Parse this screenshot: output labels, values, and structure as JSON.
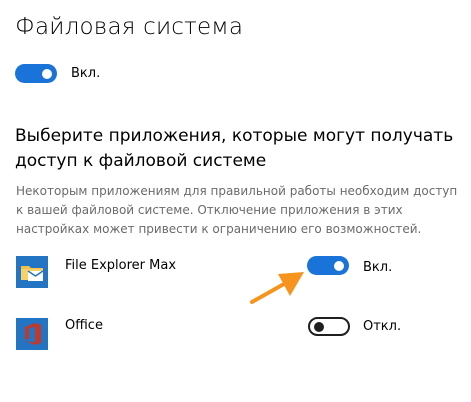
{
  "page": {
    "title": "Файловая система"
  },
  "master_toggle": {
    "state": "on",
    "label": "Вкл."
  },
  "apps_section": {
    "heading": "Выберите приложения, которые могут получать доступ к файловой системе",
    "description": "Некоторым приложениям для правильной работы необходим доступ к вашей файловой системе. Отключение приложения в этих настройках может привести к ограничению его возможностей.",
    "apps": [
      {
        "name": "File Explorer Max",
        "icon": "folder-mail-icon",
        "toggle_state": "on",
        "toggle_label": "Вкл."
      },
      {
        "name": "Office",
        "icon": "office-icon",
        "toggle_state": "off",
        "toggle_label": "Откл."
      }
    ]
  },
  "colors": {
    "accent": "#1a73d9",
    "annotation_arrow": "#f7941d",
    "description_text": "#6b6b6b",
    "office_icon": "#c0392b"
  }
}
